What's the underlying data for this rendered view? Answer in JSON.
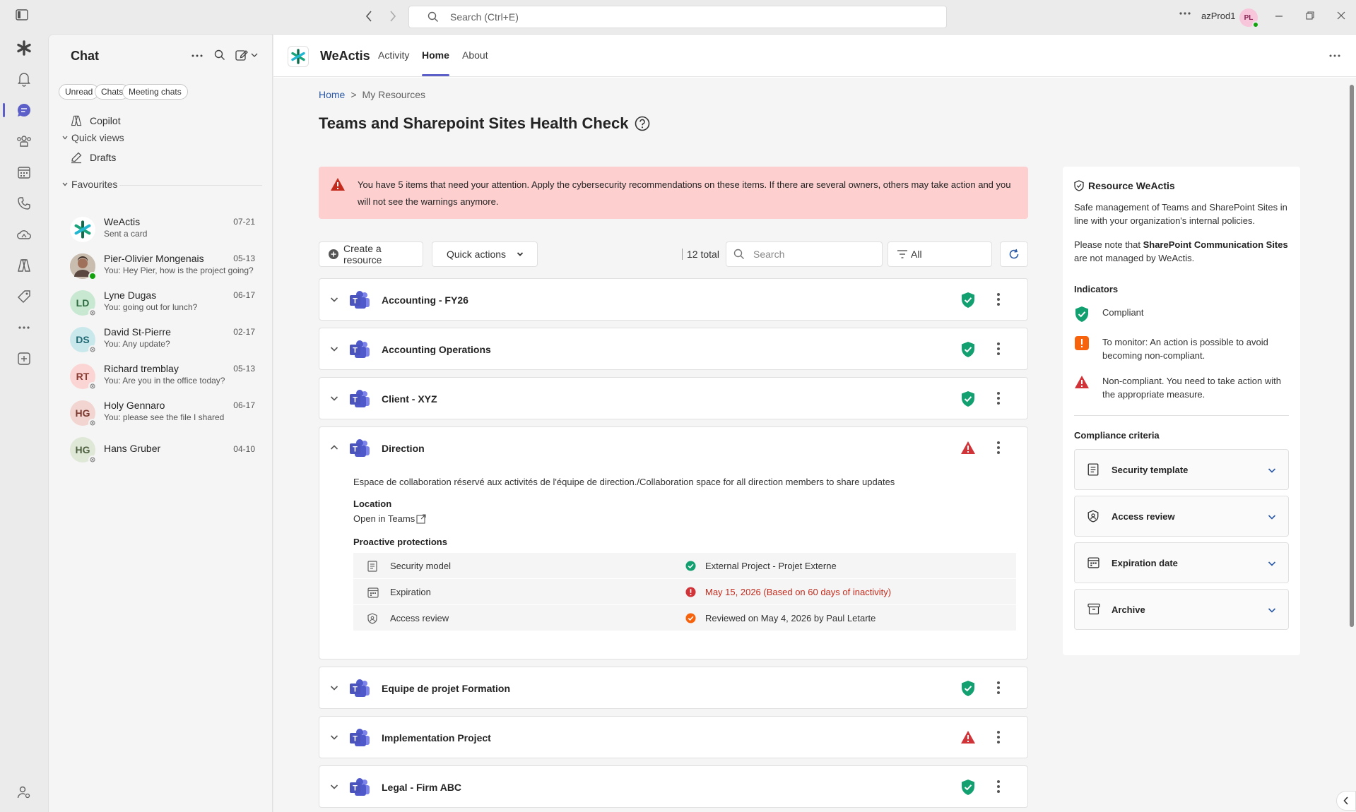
{
  "titlebar": {
    "search_placeholder": "Search (Ctrl+E)",
    "account": "azProd1",
    "avatar_initials": "PL"
  },
  "chat": {
    "title": "Chat",
    "filters": [
      "Unread",
      "Chats",
      "Meeting chats"
    ],
    "copilot": "Copilot",
    "quick_views": "Quick views",
    "drafts": "Drafts",
    "favourites": "Favourites",
    "items": [
      {
        "name": "WeActis",
        "preview": "Sent a card",
        "date": "07-21",
        "initials": "",
        "color": "#ffffff"
      },
      {
        "name": "Pier-Olivier Mongenais",
        "preview": "You: Hey Pier, how is the project going?",
        "date": "05-13",
        "initials": "",
        "color": "#c8c8c8"
      },
      {
        "name": "Lyne Dugas",
        "preview": "You: going out for lunch?",
        "date": "06-17",
        "initials": "LD",
        "color": "#c8e8d1"
      },
      {
        "name": "David St-Pierre",
        "preview": "You: Any update?",
        "date": "02-17",
        "initials": "DS",
        "color": "#c9e8ec"
      },
      {
        "name": "Richard tremblay",
        "preview": "You: Are you in the office today?",
        "date": "05-13",
        "initials": "RT",
        "color": "#fbd5d3"
      },
      {
        "name": "Holy Gennaro",
        "preview": "You: please see the file I shared",
        "date": "06-17",
        "initials": "HG",
        "color": "#f2d4d0"
      },
      {
        "name": "Hans Gruber",
        "preview": "",
        "date": "04-10",
        "initials": "HG",
        "color": "#dfe8d7"
      }
    ]
  },
  "app": {
    "name": "WeActis",
    "tabs": [
      "Activity",
      "Home",
      "About"
    ],
    "active_tab": "Home"
  },
  "page": {
    "breadcrumb_home": "Home",
    "breadcrumb_sep": ">",
    "breadcrumb_current": "My Resources",
    "title": "Teams and Sharepoint Sites Health Check",
    "alert": "You have 5 items that need your attention. Apply the cybersecurity recommendations on these items. If there are several owners, others may take action and you will not see the warnings anymore."
  },
  "toolbar": {
    "create": "Create a resource",
    "quick_actions": "Quick actions",
    "total": "12 total",
    "search_placeholder": "Search",
    "filter": "All"
  },
  "resources": [
    {
      "name": "Accounting - FY26",
      "status": "compliant"
    },
    {
      "name": "Accounting Operations",
      "status": "compliant"
    },
    {
      "name": "Client - XYZ",
      "status": "compliant"
    },
    {
      "name": "Direction",
      "status": "non-compliant",
      "expanded": true
    },
    {
      "name": "Equipe de projet Formation",
      "status": "compliant"
    },
    {
      "name": "Implementation Project",
      "status": "non-compliant"
    },
    {
      "name": "Legal - Firm ABC",
      "status": "compliant"
    }
  ],
  "direction_details": {
    "description": "Espace de collaboration réservé aux activités de l'équipe de direction./Collaboration space for all direction members to share updates",
    "location_label": "Location",
    "open_link": "Open in Teams",
    "protections_label": "Proactive protections",
    "protections": [
      {
        "name": "Security model",
        "value": "External Project - Projet Externe",
        "state": "ok"
      },
      {
        "name": "Expiration",
        "value": "May 15, 2026 (Based on 60 days of inactivity)",
        "state": "error"
      },
      {
        "name": "Access review",
        "value": "Reviewed on May 4, 2026 by Paul Letarte",
        "state": "warn"
      }
    ]
  },
  "info": {
    "title": "Resource WeActis",
    "intro": "Safe management of Teams and SharePoint Sites in line with your organization's internal policies.",
    "note_pre": "Please note that ",
    "note_bold": "SharePoint Communication Sites",
    "note_post": " are not managed by WeActis.",
    "indicators_label": "Indicators",
    "indicators": [
      "Compliant",
      "To monitor: An action is possible to avoid becoming non-compliant.",
      "Non-compliant. You need to take action with the appropriate measure."
    ],
    "criteria_label": "Compliance criteria",
    "criteria": [
      "Security template",
      "Access review",
      "Expiration date",
      "Archive"
    ]
  },
  "colors": {
    "accent": "#5b5fc7",
    "compliant": "#13a071",
    "warning": "#f7630c",
    "error": "#d13438",
    "alert_bg": "#fdcfcf"
  }
}
